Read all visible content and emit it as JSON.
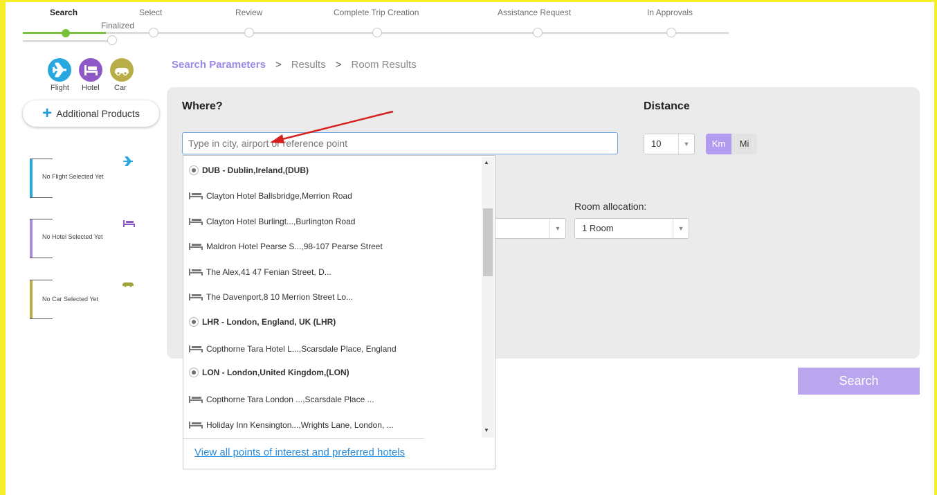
{
  "stepper": {
    "steps": [
      "Search",
      "Select",
      "Review",
      "Complete Trip Creation",
      "Assistance Request",
      "In Approvals"
    ],
    "sub_label": "Finalized"
  },
  "products": {
    "flight": "Flight",
    "hotel": "Hotel",
    "car": "Car",
    "additional": "Additional Products",
    "colors": {
      "flight": "#29a8e0",
      "hotel": "#8e59c6",
      "car": "#b9ad48"
    }
  },
  "slots": {
    "flight": "No Flight Selected Yet",
    "hotel": "No Hotel Selected Yet",
    "car": "No Car Selected Yet"
  },
  "breadcrumb": {
    "current": "Search Parameters",
    "sep": ">",
    "results": "Results",
    "room_results": "Room Results"
  },
  "form": {
    "where_label": "Where?",
    "where_placeholder": "Type in city, airport or reference point",
    "distance_label": "Distance",
    "distance_value": "10",
    "unit_km": "Km",
    "unit_mi": "Mi",
    "room_allocation_label": "Room allocation:",
    "room_allocation_value": "1 Room",
    "search_button": "Search"
  },
  "dropdown": {
    "items": [
      {
        "type": "airport",
        "text": "DUB - Dublin,Ireland,(DUB)"
      },
      {
        "type": "hotel",
        "text": "Clayton Hotel Ballsbridge,Merrion Road"
      },
      {
        "type": "hotel",
        "text": "Clayton Hotel Burlingt...,Burlington Road"
      },
      {
        "type": "hotel",
        "text": "Maldron Hotel Pearse S...,98-107 Pearse Street"
      },
      {
        "type": "hotel",
        "text": "The Alex,41 47 Fenian Street, D..."
      },
      {
        "type": "hotel",
        "text": "The Davenport,8 10 Merrion Street Lo..."
      },
      {
        "type": "airport",
        "text": "LHR - London, England, UK (LHR)"
      },
      {
        "type": "hotel",
        "text": "Copthorne Tara Hotel L...,Scarsdale Place, England"
      },
      {
        "type": "airport",
        "text": "LON - London,United Kingdom,(LON)"
      },
      {
        "type": "hotel",
        "text": "Copthorne Tara London ...,Scarsdale Place ..."
      },
      {
        "type": "hotel",
        "text": "Holiday Inn Kensington...,Wrights Lane, London, ..."
      }
    ],
    "view_all_link": "View all points of interest and preferred hotels"
  }
}
